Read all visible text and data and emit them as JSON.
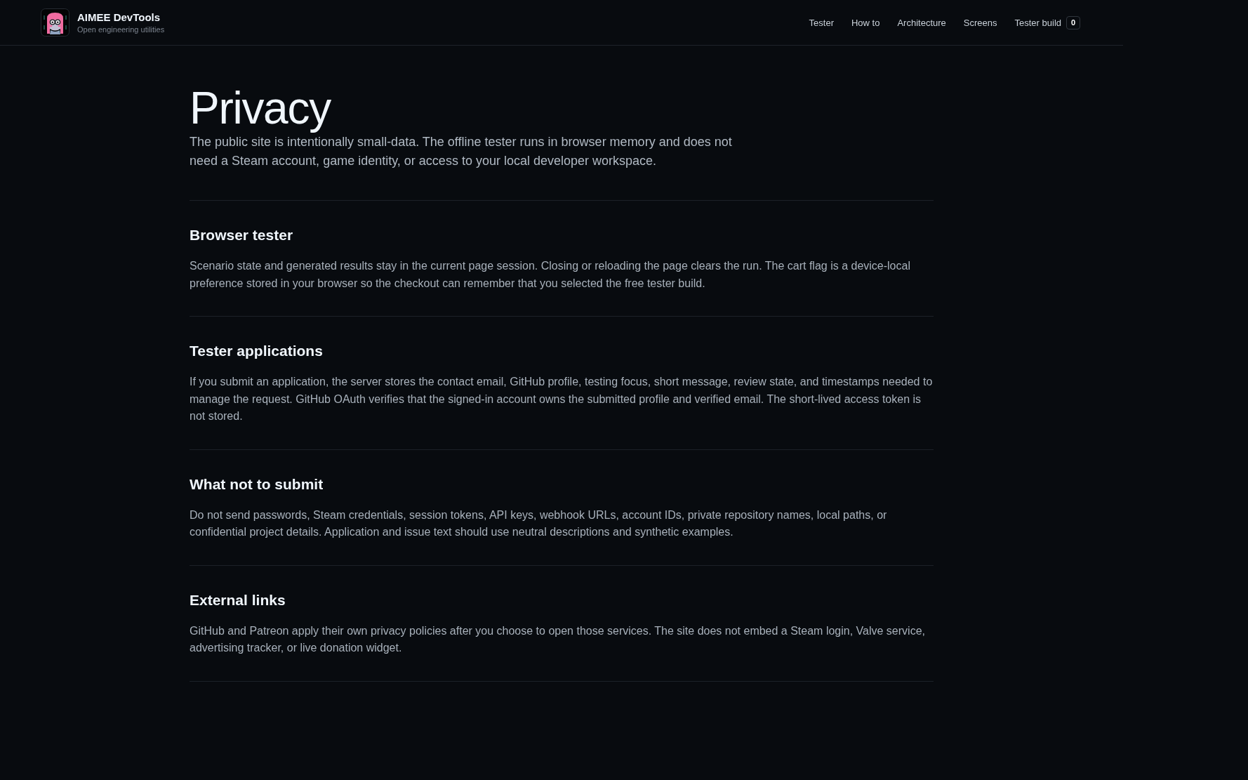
{
  "brand": {
    "title": "AIMEE DevTools",
    "tagline": "Open engineering utilities"
  },
  "nav": [
    {
      "label": "Tester"
    },
    {
      "label": "How to"
    },
    {
      "label": "Architecture"
    },
    {
      "label": "Screens"
    },
    {
      "label": "Tester build",
      "badge": "0"
    }
  ],
  "page": {
    "title": "Privacy",
    "lead": "The public site is intentionally small-data. The offline tester runs in browser memory and does not need a Steam account, game identity, or access to your local developer workspace."
  },
  "sections": [
    {
      "heading": "Browser tester",
      "body": "Scenario state and generated results stay in the current page session. Closing or reloading the page clears the run. The cart flag is a device-local preference stored in your browser so the checkout can remember that you selected the free tester build."
    },
    {
      "heading": "Tester applications",
      "body": "If you submit an application, the server stores the contact email, GitHub profile, testing focus, short message, review state, and timestamps needed to manage the request. GitHub OAuth verifies that the signed-in account owns the submitted profile and verified email. The short-lived access token is not stored."
    },
    {
      "heading": "What not to submit",
      "body": "Do not send passwords, Steam credentials, session tokens, API keys, webhook URLs, account IDs, private repository names, local paths, or confidential project details. Application and issue text should use neutral descriptions and synthetic examples."
    },
    {
      "heading": "External links",
      "body": "GitHub and Patreon apply their own privacy policies after you choose to open those services. The site does not embed a Steam login, Valve service, advertising tracker, or live donation widget."
    }
  ]
}
